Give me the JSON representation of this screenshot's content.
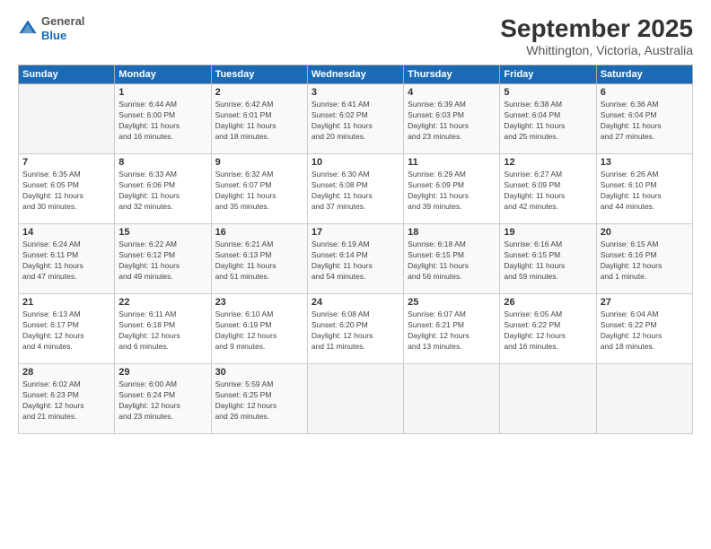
{
  "header": {
    "logo": {
      "general": "General",
      "blue": "Blue"
    },
    "title": "September 2025",
    "location": "Whittington, Victoria, Australia"
  },
  "calendar": {
    "days_of_week": [
      "Sunday",
      "Monday",
      "Tuesday",
      "Wednesday",
      "Thursday",
      "Friday",
      "Saturday"
    ],
    "weeks": [
      [
        {
          "day": "",
          "info": ""
        },
        {
          "day": "1",
          "info": "Sunrise: 6:44 AM\nSunset: 6:00 PM\nDaylight: 11 hours\nand 16 minutes."
        },
        {
          "day": "2",
          "info": "Sunrise: 6:42 AM\nSunset: 6:01 PM\nDaylight: 11 hours\nand 18 minutes."
        },
        {
          "day": "3",
          "info": "Sunrise: 6:41 AM\nSunset: 6:02 PM\nDaylight: 11 hours\nand 20 minutes."
        },
        {
          "day": "4",
          "info": "Sunrise: 6:39 AM\nSunset: 6:03 PM\nDaylight: 11 hours\nand 23 minutes."
        },
        {
          "day": "5",
          "info": "Sunrise: 6:38 AM\nSunset: 6:04 PM\nDaylight: 11 hours\nand 25 minutes."
        },
        {
          "day": "6",
          "info": "Sunrise: 6:36 AM\nSunset: 6:04 PM\nDaylight: 11 hours\nand 27 minutes."
        }
      ],
      [
        {
          "day": "7",
          "info": "Sunrise: 6:35 AM\nSunset: 6:05 PM\nDaylight: 11 hours\nand 30 minutes."
        },
        {
          "day": "8",
          "info": "Sunrise: 6:33 AM\nSunset: 6:06 PM\nDaylight: 11 hours\nand 32 minutes."
        },
        {
          "day": "9",
          "info": "Sunrise: 6:32 AM\nSunset: 6:07 PM\nDaylight: 11 hours\nand 35 minutes."
        },
        {
          "day": "10",
          "info": "Sunrise: 6:30 AM\nSunset: 6:08 PM\nDaylight: 11 hours\nand 37 minutes."
        },
        {
          "day": "11",
          "info": "Sunrise: 6:29 AM\nSunset: 6:09 PM\nDaylight: 11 hours\nand 39 minutes."
        },
        {
          "day": "12",
          "info": "Sunrise: 6:27 AM\nSunset: 6:09 PM\nDaylight: 11 hours\nand 42 minutes."
        },
        {
          "day": "13",
          "info": "Sunrise: 6:26 AM\nSunset: 6:10 PM\nDaylight: 11 hours\nand 44 minutes."
        }
      ],
      [
        {
          "day": "14",
          "info": "Sunrise: 6:24 AM\nSunset: 6:11 PM\nDaylight: 11 hours\nand 47 minutes."
        },
        {
          "day": "15",
          "info": "Sunrise: 6:22 AM\nSunset: 6:12 PM\nDaylight: 11 hours\nand 49 minutes."
        },
        {
          "day": "16",
          "info": "Sunrise: 6:21 AM\nSunset: 6:13 PM\nDaylight: 11 hours\nand 51 minutes."
        },
        {
          "day": "17",
          "info": "Sunrise: 6:19 AM\nSunset: 6:14 PM\nDaylight: 11 hours\nand 54 minutes."
        },
        {
          "day": "18",
          "info": "Sunrise: 6:18 AM\nSunset: 6:15 PM\nDaylight: 11 hours\nand 56 minutes."
        },
        {
          "day": "19",
          "info": "Sunrise: 6:16 AM\nSunset: 6:15 PM\nDaylight: 11 hours\nand 59 minutes."
        },
        {
          "day": "20",
          "info": "Sunrise: 6:15 AM\nSunset: 6:16 PM\nDaylight: 12 hours\nand 1 minute."
        }
      ],
      [
        {
          "day": "21",
          "info": "Sunrise: 6:13 AM\nSunset: 6:17 PM\nDaylight: 12 hours\nand 4 minutes."
        },
        {
          "day": "22",
          "info": "Sunrise: 6:11 AM\nSunset: 6:18 PM\nDaylight: 12 hours\nand 6 minutes."
        },
        {
          "day": "23",
          "info": "Sunrise: 6:10 AM\nSunset: 6:19 PM\nDaylight: 12 hours\nand 9 minutes."
        },
        {
          "day": "24",
          "info": "Sunrise: 6:08 AM\nSunset: 6:20 PM\nDaylight: 12 hours\nand 11 minutes."
        },
        {
          "day": "25",
          "info": "Sunrise: 6:07 AM\nSunset: 6:21 PM\nDaylight: 12 hours\nand 13 minutes."
        },
        {
          "day": "26",
          "info": "Sunrise: 6:05 AM\nSunset: 6:22 PM\nDaylight: 12 hours\nand 16 minutes."
        },
        {
          "day": "27",
          "info": "Sunrise: 6:04 AM\nSunset: 6:22 PM\nDaylight: 12 hours\nand 18 minutes."
        }
      ],
      [
        {
          "day": "28",
          "info": "Sunrise: 6:02 AM\nSunset: 6:23 PM\nDaylight: 12 hours\nand 21 minutes."
        },
        {
          "day": "29",
          "info": "Sunrise: 6:00 AM\nSunset: 6:24 PM\nDaylight: 12 hours\nand 23 minutes."
        },
        {
          "day": "30",
          "info": "Sunrise: 5:59 AM\nSunset: 6:25 PM\nDaylight: 12 hours\nand 26 minutes."
        },
        {
          "day": "",
          "info": ""
        },
        {
          "day": "",
          "info": ""
        },
        {
          "day": "",
          "info": ""
        },
        {
          "day": "",
          "info": ""
        }
      ]
    ]
  }
}
